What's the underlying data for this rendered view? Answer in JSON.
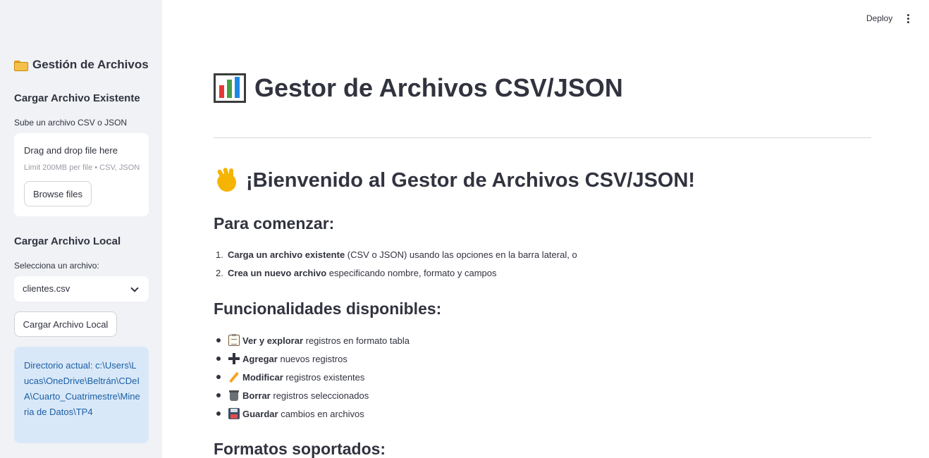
{
  "topbar": {
    "deploy_label": "Deploy",
    "menu_icon": "kebab-menu-icon"
  },
  "sidebar": {
    "title": "Gestión de Archivos",
    "title_icon": "folder-icon",
    "upload_section": {
      "heading": "Cargar Archivo Existente",
      "label": "Sube un archivo CSV o JSON",
      "dropzone_title": "Drag and drop file here",
      "dropzone_limit": "Limit 200MB per file • CSV, JSON",
      "browse_label": "Browse files"
    },
    "local_section": {
      "heading": "Cargar Archivo Local",
      "label": "Selecciona un archivo:",
      "selected": "clientes.csv",
      "button_label": "Cargar Archivo Local"
    },
    "directory_info": "Directorio actual: c:\\Users\\Lucas\\OneDrive\\Beltrán\\CDeIA\\Cuarto_Cuatrimestre\\Mineria de Datos\\TP4"
  },
  "main": {
    "title": "Gestor de Archivos CSV/JSON",
    "title_icon": "bar-chart-icon",
    "welcome": "¡Bienvenido al Gestor de Archivos CSV/JSON!",
    "welcome_icon": "waving-hand-icon",
    "start_heading": "Para comenzar:",
    "steps": [
      {
        "num": "1.",
        "bold": "Carga un archivo existente",
        "rest": " (CSV o JSON) usando las opciones en la barra lateral, o"
      },
      {
        "num": "2.",
        "bold": "Crea un nuevo archivo",
        "rest": " especificando nombre, formato y campos"
      }
    ],
    "features_heading": "Funcionalidades disponibles:",
    "features": [
      {
        "icon": "clipboard-icon",
        "bold": "Ver y explorar",
        "rest": " registros en formato tabla"
      },
      {
        "icon": "plus-icon",
        "bold": "Agregar",
        "rest": " nuevos registros"
      },
      {
        "icon": "pencil-icon",
        "bold": "Modificar",
        "rest": " registros existentes"
      },
      {
        "icon": "trash-icon",
        "bold": "Borrar",
        "rest": " registros seleccionados"
      },
      {
        "icon": "floppy-disk-icon",
        "bold": "Guardar",
        "rest": " cambios en archivos"
      }
    ],
    "formats_heading": "Formatos soportados:"
  }
}
